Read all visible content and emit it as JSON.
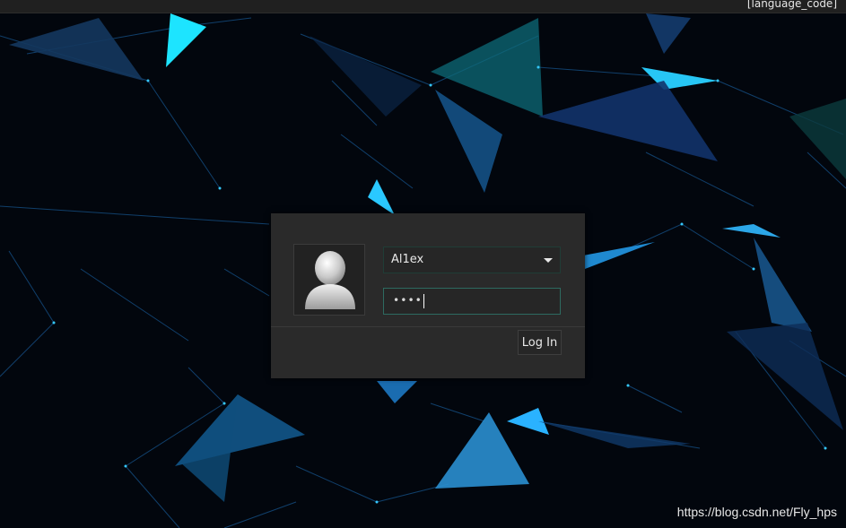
{
  "topbar": {
    "hostname": "               ",
    "language_label": "[language_code]"
  },
  "login": {
    "username": "Al1ex",
    "password_mask": "••••",
    "login_button_label": "Log In"
  },
  "watermark": "https://blog.csdn.net/Fly_hps",
  "colors": {
    "background": "#02060d",
    "panel": "#2a2a2a",
    "field_focus_border": "#2d6a60",
    "accent_cyan": "#1ec8ff"
  },
  "icons": {
    "avatar": "user-avatar-icon",
    "dropdown": "chevron-down-icon"
  }
}
